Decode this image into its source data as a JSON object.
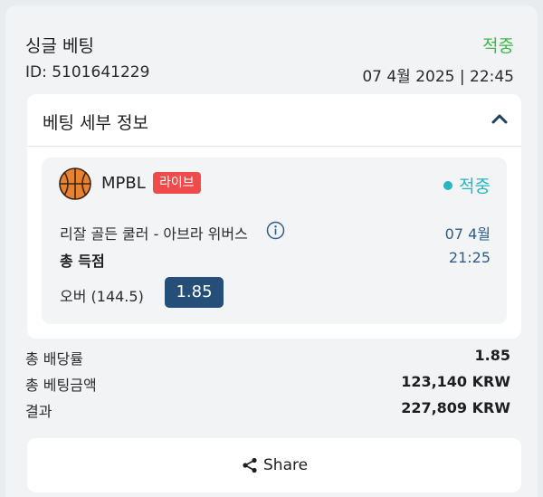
{
  "bet": {
    "type": "싱글 베팅",
    "status": "적중",
    "id": "ID: 5101641229",
    "date": "07 4월 2025 | 22:45"
  },
  "details": {
    "title": "베팅 세부 정보",
    "event": {
      "league": "MPBL",
      "live_badge": "라이브",
      "status": "적중",
      "match": "리잘 골든 쿨러 - 아브라 위버스",
      "date": "07 4월",
      "market": "총 득점",
      "time": "21:25",
      "selection": "오버 (144.5)",
      "odds": "1.85"
    }
  },
  "summary": {
    "total_odds_label": "총 배당률",
    "total_odds_value": "1.85",
    "stake_label": "총 베팅금액",
    "stake_value": "123,140 KRW",
    "result_label": "결과",
    "result_value": "227,809 KRW"
  },
  "share": {
    "label": "Share"
  },
  "colors": {
    "win_green": "#3cb84a",
    "status_teal": "#27b6c4",
    "live_red": "#ef4b4b",
    "odds_blue": "#254f79"
  },
  "icons": {
    "collapse": "chevron-up-icon",
    "sport": "basketball-icon",
    "info": "info-icon",
    "share": "share-icon"
  }
}
